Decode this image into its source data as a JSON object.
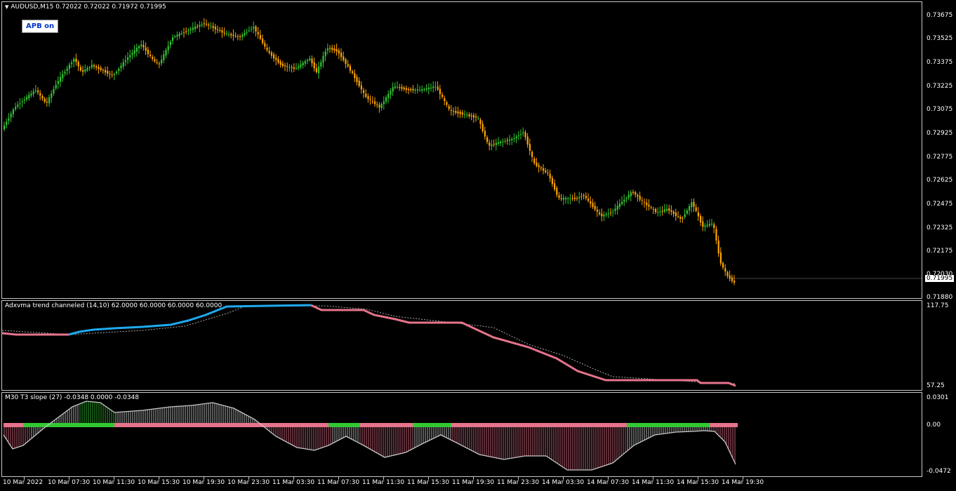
{
  "main": {
    "symbol_line": "AUDUSD,M15  0.72022 0.72022 0.71972 0.71995",
    "apb_button": "APB on",
    "price_labels": [
      "0.73675",
      "0.73525",
      "0.73375",
      "0.73225",
      "0.73075",
      "0.72925",
      "0.72775",
      "0.72625",
      "0.72475",
      "0.72325",
      "0.72175",
      "0.72030",
      "0.71880"
    ],
    "current_price": "0.71995",
    "colors": {
      "up": "#32c832",
      "down": "#ffa500",
      "background": "#000000",
      "grid": "#c8c8c8"
    }
  },
  "adx": {
    "title": "Adxvma trend channeled (14,10) 62.0000 60.0000 60.0000 60.0000",
    "labels": [
      "117.75",
      "57.25"
    ],
    "colors": {
      "up": "#1eaaf0",
      "down": "#e6738c",
      "dotted": "#aaaaaa"
    }
  },
  "t3": {
    "title": "M30 T3 slope (27) -0.0348 0.0000 -0.0348",
    "labels": [
      "0.0301",
      "0.00",
      "-0.0472"
    ],
    "colors": {
      "pos": "#32c832",
      "neg": "#e6738c",
      "line": "#c8c8c8"
    }
  },
  "time_axis": [
    "10 Mar 2022",
    "10 Mar 07:30",
    "10 Mar 11:30",
    "10 Mar 15:30",
    "10 Mar 19:30",
    "10 Mar 23:30",
    "11 Mar 03:30",
    "11 Mar 07:30",
    "11 Mar 11:30",
    "11 Mar 15:30",
    "11 Mar 19:30",
    "11 Mar 23:30",
    "14 Mar 03:30",
    "14 Mar 07:30",
    "14 Mar 11:30",
    "14 Mar 15:30",
    "14 Mar 19:30"
  ]
}
